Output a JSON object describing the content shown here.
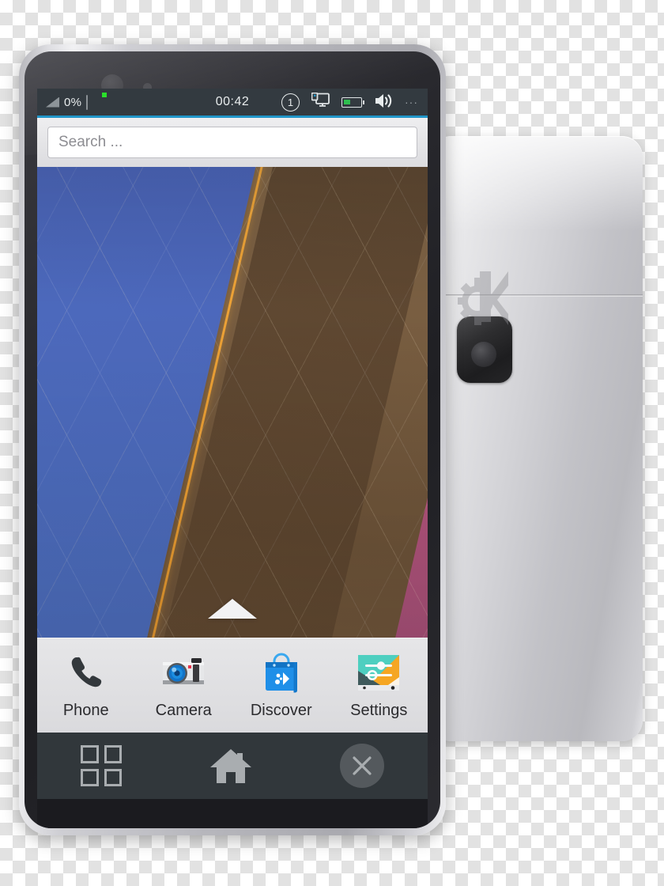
{
  "scene": {
    "description": "KDE Plasma Mobile smartphone mockup, front device with homescreen and rear device",
    "transparent_checker_background": true
  },
  "back_phone": {
    "body_color": "#cfcfd4",
    "camera_module": "rear-camera-icon",
    "branding_logo": "kde-gear-k-logo"
  },
  "front_phone": {
    "frame_color": "#b7b7bd",
    "glass_color": "#26262b",
    "front_camera": "front-camera-icon",
    "proximity_sensor": "proximity-sensor-icon"
  },
  "statusbar": {
    "background": "#333a40",
    "accent": "#2196c9",
    "signal_icon": "signal-strength-icon",
    "battery_percent": "0%",
    "keyboard_icon": "virtual-keyboard-icon",
    "keyboard_indicator_color": "#2ae02a",
    "clock": "00:42",
    "notification_count": "1",
    "display_icon": "display-monitor-icon",
    "battery_icon": "battery-icon",
    "battery_fill_color": "#2fbf4f",
    "volume_icon": "volume-speaker-icon",
    "overflow": "···"
  },
  "search": {
    "placeholder": "Search ...",
    "value": ""
  },
  "wallpaper": {
    "name": "plasma-geometric-wallpaper",
    "colors": [
      "#4d63b8",
      "#8a5a98",
      "#b4547c",
      "#7a5f42",
      "#f0a83c"
    ],
    "drawer_handle_icon": "up-arrow-drawer-handle"
  },
  "dock": {
    "items": [
      {
        "label": "Phone",
        "icon": "phone-handset-icon"
      },
      {
        "label": "Camera",
        "icon": "camera-icon"
      },
      {
        "label": "Discover",
        "icon": "discover-shopping-bag-icon"
      },
      {
        "label": "Settings",
        "icon": "settings-sliders-icon"
      }
    ]
  },
  "navbar": {
    "background": "#31373b",
    "buttons": [
      {
        "name": "app-drawer",
        "icon": "grid-four-squares-icon"
      },
      {
        "name": "home",
        "icon": "home-house-icon"
      },
      {
        "name": "close",
        "icon": "close-x-circle-icon"
      }
    ]
  }
}
